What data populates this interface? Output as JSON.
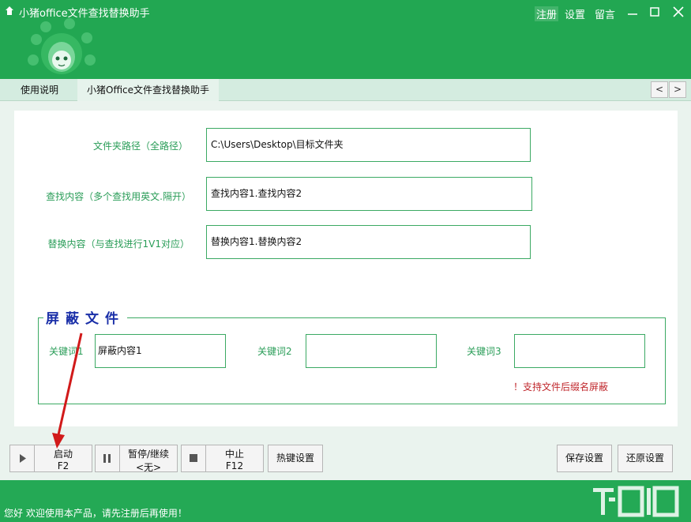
{
  "app": {
    "title": "小猪office文件查找替换助手"
  },
  "top_links": {
    "register": "注册",
    "settings": "设置",
    "message": "留言"
  },
  "tabs": [
    {
      "label": "使用说明"
    },
    {
      "label": "小猪Office文件查找替换助手"
    }
  ],
  "nav": {
    "prev": "<",
    "next": ">"
  },
  "form": {
    "folder_label": "文件夹路径（全路径）",
    "folder_value": "C:\\Users\\Desktop\\目标文件夹",
    "find_label": "查找内容（多个查找用英文.隔开）",
    "find_value": "查找内容1.查找内容2",
    "replace_label": "替换内容（与查找进行1V1对应）",
    "replace_value": "替换内容1.替换内容2"
  },
  "mask_group": {
    "title": "屏蔽文件",
    "kw1_label": "关键词1",
    "kw1_value": "屏蔽内容1",
    "kw2_label": "关键词2",
    "kw2_value": "",
    "kw3_label": "关键词3",
    "kw3_value": "",
    "note": "！支持文件后缀名屏蔽"
  },
  "toolbar": {
    "start_label": "启动",
    "start_key": "F2",
    "pause_label": "暂停/继续",
    "pause_key": "<无>",
    "stop_label": "中止",
    "stop_key": "F12",
    "hotkey_label": "热键设置",
    "save_label": "保存设置",
    "restore_label": "还原设置"
  },
  "status": {
    "text": "您好 欢迎使用本产品，请先注册后再使用！"
  },
  "colors": {
    "brand_green": "#24a955",
    "field_border": "#3ba963",
    "label_green": "#2a9d58",
    "group_title": "#1a2fa8",
    "warning": "#c0282d"
  }
}
